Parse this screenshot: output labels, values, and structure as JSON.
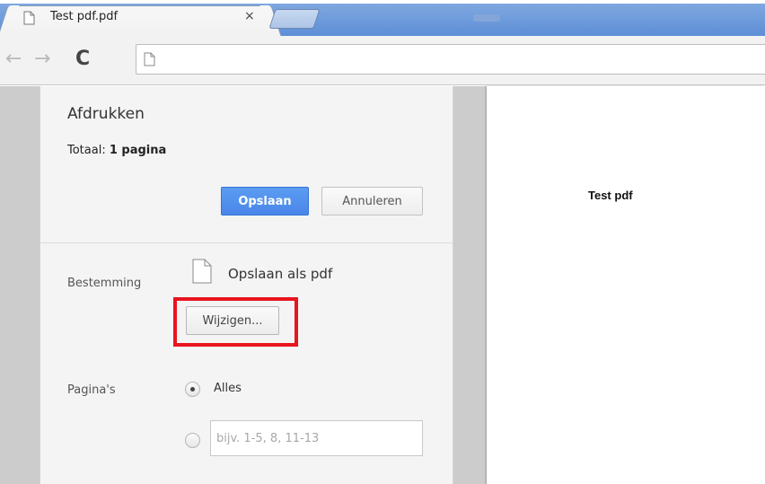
{
  "tab": {
    "title": "Test pdf.pdf",
    "close": "×",
    "icon": "document-icon"
  },
  "toolbar": {
    "back": "←",
    "forward": "→",
    "reload": "C",
    "url": ""
  },
  "print_panel": {
    "title": "Afdrukken",
    "total_label": "Totaal: ",
    "total_value": "1 pagina",
    "save_button": "Opslaan",
    "cancel_button": "Annuleren",
    "destination_label": "Bestemming",
    "destination_name": "Opslaan als pdf",
    "change_button": "Wijzigen...",
    "pages_label": "Pagina's",
    "pages_all_option": "Alles",
    "pages_range_placeholder": "bijv. 1-5, 8, 11-13",
    "pages_selected": "Alles"
  },
  "preview": {
    "page_text": "Test pdf"
  },
  "colors": {
    "save_button": "#4a86e8",
    "highlight_border": "#e8141e",
    "tab_strip": "#6a97dc"
  }
}
